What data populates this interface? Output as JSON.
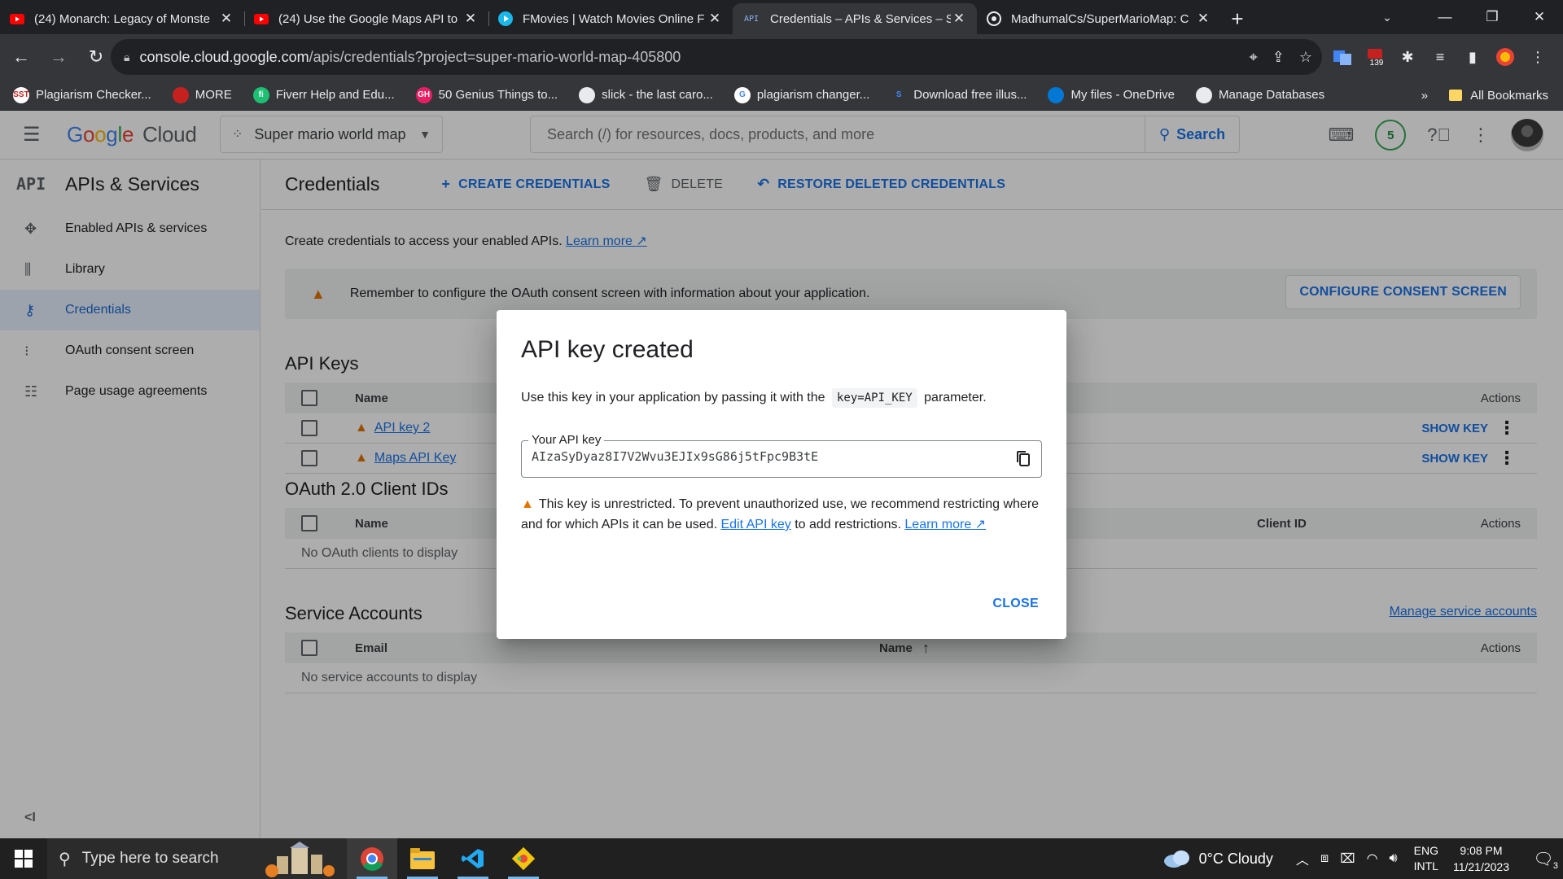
{
  "browser": {
    "tabs": [
      {
        "title": "(24) Monarch: Legacy of Monste",
        "icon": "youtube-icon",
        "active": false
      },
      {
        "title": "(24) Use the Google Maps API to",
        "icon": "youtube-icon",
        "active": false
      },
      {
        "title": "FMovies | Watch Movies Online F",
        "icon": "play-icon",
        "active": false
      },
      {
        "title": "Credentials – APIs & Services – S",
        "icon": "api-icon",
        "active": true
      },
      {
        "title": "MadhumalCs/SuperMarioMap: C",
        "icon": "github-icon",
        "active": false
      }
    ],
    "url_host": "console.cloud.google.com",
    "url_path": "/apis/credentials?project=super-mario-world-map-405800",
    "extension_badge": "139",
    "bookmarks": [
      {
        "label": "Plagiarism Checker...",
        "icon_color": "#ffffff",
        "icon_text": "SST",
        "text_color": "#c5221f"
      },
      {
        "label": "MORE",
        "icon_color": "#c5221f",
        "icon_text": "",
        "text_color": "#ffffff"
      },
      {
        "label": "Fiverr Help and Edu...",
        "icon_color": "#1dbf73",
        "icon_text": "fi",
        "text_color": "#ffffff"
      },
      {
        "label": "50 Genius Things to...",
        "icon_color": "#e91e63",
        "icon_text": "GH",
        "text_color": "#ffffff"
      },
      {
        "label": "slick - the last caro...",
        "icon_color": "#e8eaed",
        "icon_text": "",
        "text_color": "#35363a"
      },
      {
        "label": "plagiarism changer...",
        "icon_color": "#ffffff",
        "icon_text": "G",
        "text_color": "#4285f4"
      },
      {
        "label": "Download free illus...",
        "icon_color": "#35363a",
        "icon_text": "S",
        "text_color": "#4285f4"
      },
      {
        "label": "My files - OneDrive",
        "icon_color": "#0078d4",
        "icon_text": "",
        "text_color": "#ffffff"
      },
      {
        "label": "Manage Databases",
        "icon_color": "#e8eaed",
        "icon_text": "",
        "text_color": "#35363a"
      }
    ],
    "bookmarks_overflow": "»",
    "all_bookmarks": "All Bookmarks"
  },
  "console": {
    "logo_letters": [
      "G",
      "o",
      "o",
      "g",
      "l",
      "e"
    ],
    "logo_suffix": "Cloud",
    "project_name": "Super mario world map",
    "search_placeholder": "Search (/) for resources, docs, products, and more",
    "search_button": "Search",
    "notifications_count": "5"
  },
  "sidebar": {
    "section_icon": "API",
    "section_title": "APIs & Services",
    "items": [
      {
        "label": "Enabled APIs & services",
        "icon": "enabled-apis-icon",
        "active": false
      },
      {
        "label": "Library",
        "icon": "library-icon",
        "active": false
      },
      {
        "label": "Credentials",
        "icon": "key-icon",
        "active": true
      },
      {
        "label": "OAuth consent screen",
        "icon": "consent-icon",
        "active": false
      },
      {
        "label": "Page usage agreements",
        "icon": "settings-list-icon",
        "active": false
      }
    ],
    "collapse": "<I"
  },
  "page": {
    "title": "Credentials",
    "actions": {
      "create": "CREATE CREDENTIALS",
      "delete": "DELETE",
      "restore": "RESTORE DELETED CREDENTIALS"
    },
    "intro_text": "Create credentials to access your enabled APIs.",
    "intro_link": "Learn more",
    "banner_text": "Remember to configure the OAuth consent screen with information about your application.",
    "banner_button": "CONFIGURE CONSENT SCREEN",
    "api_keys": {
      "title": "API Keys",
      "col_name": "Name",
      "col_actions": "Actions",
      "rows": [
        {
          "name": "API key 2",
          "action": "SHOW KEY"
        },
        {
          "name": "Maps API Key",
          "action": "SHOW KEY"
        }
      ]
    },
    "oauth": {
      "title": "OAuth 2.0 Client IDs",
      "col_name": "Name",
      "col_client": "Client ID",
      "col_actions": "Actions",
      "empty": "No OAuth clients to display"
    },
    "service_accounts": {
      "title": "Service Accounts",
      "manage_link": "Manage service accounts",
      "col_email": "Email",
      "col_name": "Name",
      "col_actions": "Actions",
      "empty": "No service accounts to display"
    }
  },
  "dialog": {
    "title": "API key created",
    "desc_before": "Use this key in your application by passing it with the",
    "desc_code": "key=API_KEY",
    "desc_after": "parameter.",
    "field_label": "Your API key",
    "api_key": "AIzaSyDyaz8I7V2Wvu3EJIx9sG86j5tFpc9B3tE",
    "warn_text": "This key is unrestricted. To prevent unauthorized use, we recommend restricting where and for which APIs it can be used.",
    "edit_link": "Edit API key",
    "warn_middle": "to add restrictions.",
    "learn_more": "Learn more",
    "close": "CLOSE"
  },
  "taskbar": {
    "search_placeholder": "Type here to search",
    "weather": "0°C  Cloudy",
    "lang_top": "ENG",
    "lang_bottom": "INTL",
    "time": "9:08 PM",
    "date": "11/21/2023",
    "notif_count": "3"
  }
}
